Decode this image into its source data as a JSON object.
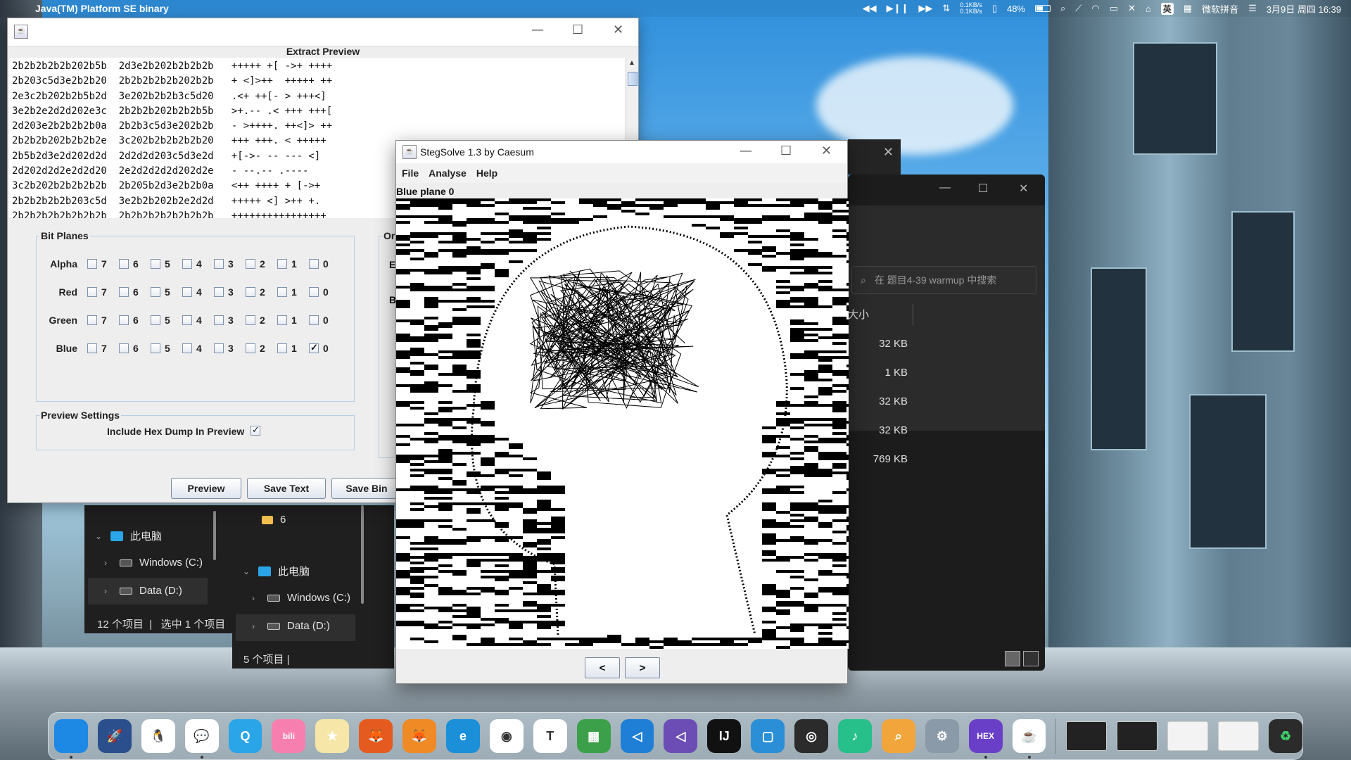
{
  "menubar": {
    "app_name": "Java(TM) Platform SE binary",
    "net_up": "0.1KB/s",
    "net_down": "0.1KB/s",
    "battery": "48%",
    "ime_lang": "英",
    "ime_name": "微软拼音",
    "datetime": "3月9日 周四 16:39"
  },
  "extract": {
    "caption": "Extract Preview",
    "hex_lines": [
      "2b2b2b2b2b202b5b  2d3e2b202b2b2b2b   +++++ +[ ->+ ++++",
      "2b203c5d3e2b2b20  2b2b2b2b2b202b2b   + <]>++  +++++ ++",
      "2e3c2b202b2b5b2d  3e202b2b2b3c5d20   .<+ ++[- > +++<]",
      "3e2b2e2d2d202e3c  2b2b2b202b2b2b5b   >+.-- .< +++ +++[",
      "2d203e2b2b2b2b0a  2b2b3c5d3e202b2b   - >++++. ++<]> ++",
      "2b2b2b202b2b2b2e  3c202b2b2b2b2b20   +++ +++. < +++++",
      "2b5b2d3e2d202d2d  2d2d2d203c5d3e2d   +[->- -- --- <]",
      "2d202d2d2e2d2d20  2e2d2d2d2d202d2e   - --.-- .----",
      "3c2b202b2b2b2b2b  2b205b2d3e2b2b0a   <++ ++++ + [->+",
      "2b2b2b2b2b203c5d  3e2b2b202b2e2d2d   +++++ <] >++ +.",
      "2b2b2b2b2b2b2b2b  2b2b2b2b2b2b2b2b   ++++++++++++++++"
    ],
    "bit_planes": {
      "legend": "Bit Planes",
      "rows": [
        {
          "label": "Alpha",
          "checked": []
        },
        {
          "label": "Red",
          "checked": []
        },
        {
          "label": "Green",
          "checked": []
        },
        {
          "label": "Blue",
          "checked": [
            "0"
          ]
        }
      ],
      "bits": [
        "7",
        "6",
        "5",
        "4",
        "3",
        "2",
        "1",
        "0"
      ]
    },
    "order_legend": "Or",
    "order_e1": "E",
    "order_e2": "B",
    "preview_settings": {
      "legend": "Preview Settings",
      "include_hex_label": "Include Hex Dump In Preview",
      "include_hex_checked": true
    },
    "buttons": {
      "preview": "Preview",
      "save_text": "Save Text",
      "save_bin": "Save Bin"
    }
  },
  "stegsolve": {
    "title": "StegSolve 1.3 by Caesum",
    "menu": [
      "File",
      "Analyse",
      "Help"
    ],
    "plane_label": "Blue plane 0",
    "prev": "<",
    "next": ">"
  },
  "explorer_right": {
    "search_placeholder": "在 题目4-39 warmup 中搜索",
    "size_header": "大小",
    "sizes": [
      "32 KB",
      "1 KB",
      "32 KB",
      "32 KB",
      "769 KB"
    ]
  },
  "explorer_a": {
    "this_pc": "此电脑",
    "drive_c": "Windows (C:)",
    "drive_d": "Data (D:)",
    "status_count": "12 个项目",
    "status_sel": "选中 1 个项目"
  },
  "explorer_b": {
    "folder": "6",
    "this_pc": "此电脑",
    "drive_c": "Windows (C:)",
    "drive_d": "Data (D:)",
    "status_count": "5 个项目"
  },
  "dock": {
    "icons": [
      {
        "name": "finder-icon",
        "color": "#1e88e5",
        "glyph": ""
      },
      {
        "name": "launchpad-icon",
        "color": "#2b4f8c",
        "glyph": "🚀"
      },
      {
        "name": "qq-icon",
        "color": "#ffffff",
        "glyph": "🐧"
      },
      {
        "name": "wechat-icon",
        "color": "#ffffff",
        "glyph": "💬"
      },
      {
        "name": "qq-browser-icon",
        "color": "#2aa5e8",
        "glyph": "Q"
      },
      {
        "name": "bilibili-icon",
        "color": "#f77fb0",
        "glyph": "bili"
      },
      {
        "name": "star-app-icon",
        "color": "#f6e7a8",
        "glyph": "★"
      },
      {
        "name": "firefox-icon",
        "color": "#e55b1f",
        "glyph": "🦊"
      },
      {
        "name": "firefox-dev-icon",
        "color": "#f08a24",
        "glyph": "🦊"
      },
      {
        "name": "edge-icon",
        "color": "#1b8fd8",
        "glyph": "e"
      },
      {
        "name": "chrome-icon",
        "color": "#ffffff",
        "glyph": "◉"
      },
      {
        "name": "typora-icon",
        "color": "#ffffff",
        "glyph": "T"
      },
      {
        "name": "colorful-app-icon",
        "color": "#3ca04a",
        "glyph": "▦"
      },
      {
        "name": "vscode-icon",
        "color": "#1f7fd6",
        "glyph": "◁"
      },
      {
        "name": "visual-studio-icon",
        "color": "#6b4db5",
        "glyph": "◁"
      },
      {
        "name": "intellij-icon",
        "color": "#111111",
        "glyph": "IJ"
      },
      {
        "name": "window-app-icon",
        "color": "#2a8fd6",
        "glyph": "▢"
      },
      {
        "name": "obs-icon",
        "color": "#2b2b2b",
        "glyph": "◎"
      },
      {
        "name": "music-app-icon",
        "color": "#27c08a",
        "glyph": "♪"
      },
      {
        "name": "search-app-icon",
        "color": "#f2a53a",
        "glyph": "⌕"
      },
      {
        "name": "settings-icon",
        "color": "#8a9aa8",
        "glyph": "⚙"
      },
      {
        "name": "hex-editor-icon",
        "color": "#6a3fc7",
        "glyph": "HEX"
      },
      {
        "name": "java-icon",
        "color": "#ffffff",
        "glyph": "☕"
      }
    ],
    "recycle_glyph": "♻"
  }
}
